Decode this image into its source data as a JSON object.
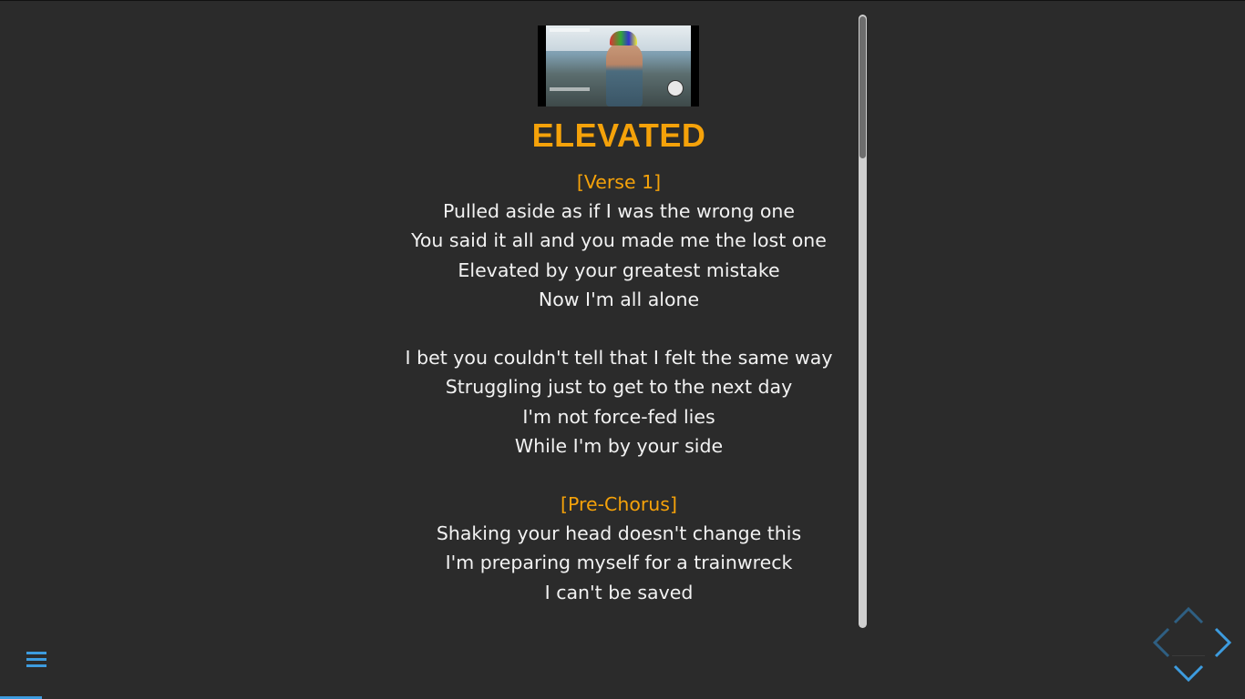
{
  "song": {
    "title": "ELEVATED",
    "thumbnail_icon": "music-video-thumbnail"
  },
  "lyrics": [
    {
      "type": "section",
      "text": "[Verse 1]"
    },
    {
      "type": "line",
      "text": "Pulled aside as if I was the wrong one"
    },
    {
      "type": "line",
      "text": "You said it all and you made me the lost one"
    },
    {
      "type": "line",
      "text": "Elevated by your greatest mistake"
    },
    {
      "type": "line",
      "text": "Now I'm all alone"
    },
    {
      "type": "gap"
    },
    {
      "type": "line",
      "text": "I bet you couldn't tell that I felt the same way"
    },
    {
      "type": "line",
      "text": "Struggling just to get to the next day"
    },
    {
      "type": "line",
      "text": "I'm not force-fed lies"
    },
    {
      "type": "line",
      "text": "While I'm by your side"
    },
    {
      "type": "gap"
    },
    {
      "type": "section",
      "text": "[Pre-Chorus]"
    },
    {
      "type": "line",
      "text": "Shaking your head doesn't change this"
    },
    {
      "type": "line",
      "text": "I'm preparing myself for a trainwreck"
    },
    {
      "type": "line",
      "text": "I can't be saved"
    }
  ],
  "scroll": {
    "position_fraction": 0.0
  },
  "controls": {
    "menu_icon": "hamburger-menu-icon",
    "nav_icons": [
      "chevron-up-icon",
      "chevron-left-icon",
      "chevron-right-icon",
      "chevron-down-icon"
    ]
  },
  "colors": {
    "background": "#2b2b2b",
    "accent_orange": "#f5a20a",
    "lyric_text": "#f2f2f2",
    "accent_blue": "#3d9cdf",
    "dim_blue": "#2f5f82"
  }
}
